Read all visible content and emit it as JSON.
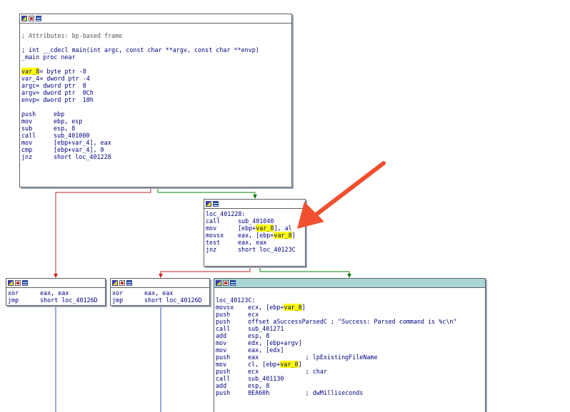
{
  "colors": {
    "background": "#ffffff",
    "edge_false": "#cc2020",
    "edge_true": "#108010",
    "edge_uncond": "#3050c0",
    "highlight": "#ffff00",
    "annotation_arrow": "#f05030"
  },
  "icons": [
    "graph-node-icon",
    "edit-icon",
    "list-icon"
  ],
  "blocks": {
    "main": {
      "lines": [
        {
          "t": ""
        },
        {
          "t": "; Attributes: bp-based frame",
          "cmt": true
        },
        {
          "t": ""
        },
        {
          "t": "; int __cdecl main(int argc, const char **argv, const char **envp)"
        },
        {
          "t": "_main proc near"
        },
        {
          "t": ""
        },
        {
          "p": "",
          "h": "var_8",
          "s": "= byte ptr -8"
        },
        {
          "t": "var_4= dword ptr -4"
        },
        {
          "t": "argc= dword ptr  8"
        },
        {
          "t": "argv= dword ptr  0Ch"
        },
        {
          "t": "envp= dword ptr  10h"
        },
        {
          "t": ""
        },
        {
          "m": "push",
          "o": "ebp"
        },
        {
          "m": "mov",
          "o": "ebp, esp"
        },
        {
          "m": "sub",
          "o": "esp, 8"
        },
        {
          "m": "call",
          "o": "sub_401000"
        },
        {
          "m": "mov",
          "o": "[ebp+var_4], eax"
        },
        {
          "m": "cmp",
          "o": "[ebp+var_4], 0"
        },
        {
          "m": "jnz",
          "o": "short loc_401228"
        }
      ]
    },
    "loc_401228": {
      "lines": [
        {
          "t": "loc_401228:"
        },
        {
          "m": "call",
          "o": "sub_401040"
        },
        {
          "m": "mov",
          "p": "[ebp+",
          "h": "var_8",
          "s": "], al"
        },
        {
          "m": "movsx",
          "p": "eax, [ebp+",
          "h": "var_8",
          "s": "]"
        },
        {
          "m": "test",
          "o": "eax, eax"
        },
        {
          "m": "jnz",
          "o": "short loc_40123C"
        }
      ]
    },
    "fail1": {
      "lines": [
        {
          "m": "xor",
          "o": "eax, eax"
        },
        {
          "m": "jmp",
          "o": "short loc_40126D"
        }
      ]
    },
    "fail2": {
      "lines": [
        {
          "m": "xor",
          "o": "eax, eax"
        },
        {
          "m": "jmp",
          "o": "short loc_40126D"
        }
      ]
    },
    "loc_40123C": {
      "lines": [
        {
          "t": ""
        },
        {
          "t": "loc_40123C:"
        },
        {
          "m": "movsx",
          "p": "ecx, [ebp+",
          "h": "var_8",
          "s": "]"
        },
        {
          "m": "push",
          "o": "ecx"
        },
        {
          "m": "push",
          "o": "offset aSuccessParsedC ; \"Success: Parsed command is %c\\n\""
        },
        {
          "m": "call",
          "o": "sub_401271"
        },
        {
          "m": "add",
          "o": "esp, 8"
        },
        {
          "m": "mov",
          "o": "edx, [ebp+argv]"
        },
        {
          "m": "mov",
          "o": "eax, [edx]"
        },
        {
          "m": "push",
          "o": "eax             ; lpExistingFileName"
        },
        {
          "m": "mov",
          "p": "cl, [ebp+",
          "h": "var_8",
          "s": "]"
        },
        {
          "m": "push",
          "o": "ecx             ; char"
        },
        {
          "m": "call",
          "o": "sub_401130"
        },
        {
          "m": "add",
          "o": "esp, 8"
        },
        {
          "m": "push",
          "o": "0EA60h          ; dwMilliseconds"
        }
      ]
    }
  }
}
